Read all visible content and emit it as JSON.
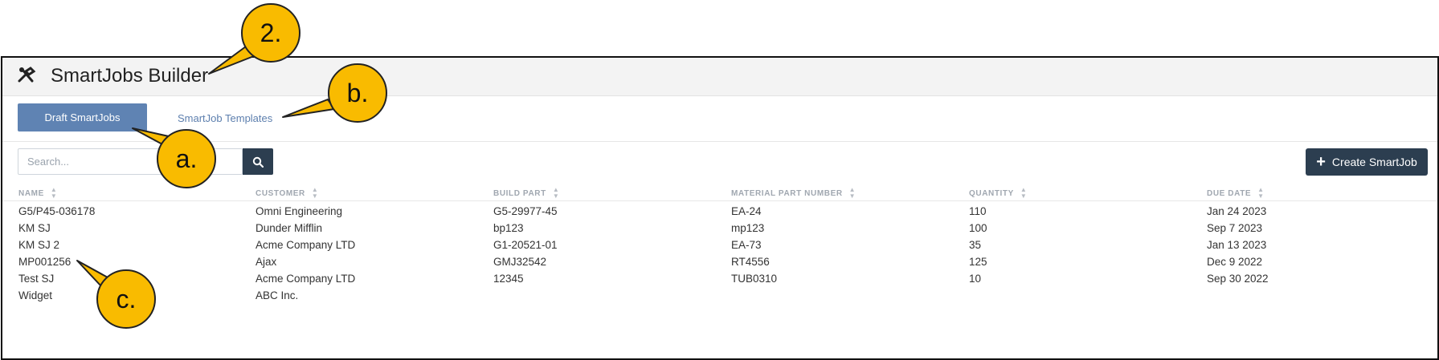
{
  "header": {
    "title": "SmartJobs Builder",
    "icon": "tools-icon"
  },
  "tabs": [
    {
      "label": "Draft SmartJobs",
      "active": true
    },
    {
      "label": "SmartJob Templates",
      "active": false
    }
  ],
  "search": {
    "placeholder": "Search...",
    "value": ""
  },
  "toolbar": {
    "create_label": "Create SmartJob"
  },
  "table": {
    "columns": [
      "NAME",
      "CUSTOMER",
      "BUILD PART",
      "MATERIAL PART NUMBER",
      "QUANTITY",
      "DUE DATE"
    ],
    "rows": [
      [
        "G5/P45-036178",
        "Omni Engineering",
        "G5-29977-45",
        "EA-24",
        "110",
        "Jan 24 2023"
      ],
      [
        "KM SJ",
        "Dunder Mifflin",
        "bp123",
        "mp123",
        "100",
        "Sep 7 2023"
      ],
      [
        "KM SJ 2",
        "Acme Company LTD",
        "G1-20521-01",
        "EA-73",
        "35",
        "Jan 13 2023"
      ],
      [
        "MP001256",
        "Ajax",
        "GMJ32542",
        "RT4556",
        "125",
        "Dec 9 2022"
      ],
      [
        "Test SJ",
        "Acme Company LTD",
        "12345",
        "TUB0310",
        "10",
        "Sep 30 2022"
      ],
      [
        "Widget",
        "ABC Inc.",
        "",
        "",
        "",
        ""
      ]
    ]
  },
  "callouts": {
    "two": "2.",
    "b": "b.",
    "a": "a.",
    "c": "c."
  },
  "colors": {
    "primary": "#5f83b3",
    "dark": "#2c3e50",
    "callout": "#f9bb00",
    "link": "#5d7fae"
  }
}
